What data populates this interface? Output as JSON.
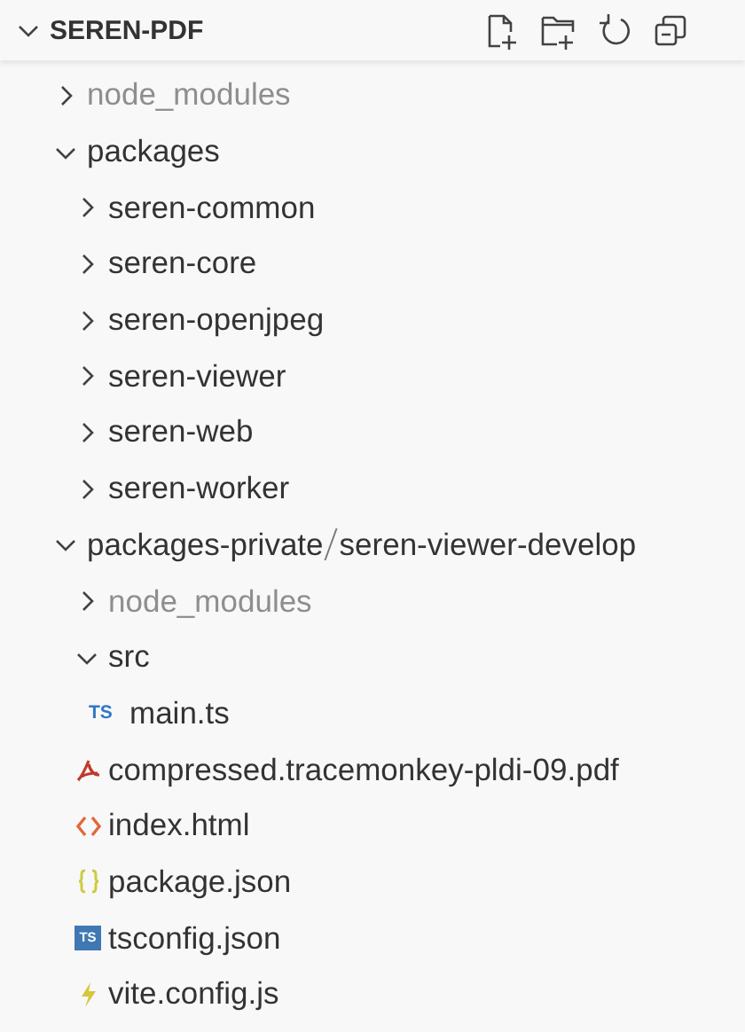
{
  "header": {
    "title": "SEREN-PDF",
    "expanded": true,
    "actions": [
      {
        "kind": "new-file"
      },
      {
        "kind": "new-folder"
      },
      {
        "kind": "refresh"
      },
      {
        "kind": "collapse-all"
      }
    ]
  },
  "tree": [
    {
      "kind": "folder",
      "name": "node_modules",
      "expanded": false,
      "ignored": true
    },
    {
      "kind": "folder",
      "name": "packages",
      "expanded": true,
      "ignored": false,
      "children": [
        {
          "kind": "folder",
          "name": "seren-common",
          "expanded": false,
          "ignored": false
        },
        {
          "kind": "folder",
          "name": "seren-core",
          "expanded": false,
          "ignored": false
        },
        {
          "kind": "folder",
          "name": "seren-openjpeg",
          "expanded": false,
          "ignored": false
        },
        {
          "kind": "folder",
          "name": "seren-viewer",
          "expanded": false,
          "ignored": false
        },
        {
          "kind": "folder",
          "name": "seren-web",
          "expanded": false,
          "ignored": false
        },
        {
          "kind": "folder",
          "name": "seren-worker",
          "expanded": false,
          "ignored": false
        }
      ]
    },
    {
      "kind": "compact-folder",
      "segments": [
        "packages-private",
        "seren-viewer-develop"
      ],
      "expanded": true,
      "ignored": false,
      "children": [
        {
          "kind": "folder",
          "name": "node_modules",
          "expanded": false,
          "ignored": true
        },
        {
          "kind": "folder",
          "name": "src",
          "expanded": true,
          "ignored": false,
          "children": [
            {
              "kind": "ts-file",
              "icon_text": "TS",
              "name": "main.ts"
            }
          ]
        },
        {
          "kind": "pdf-file",
          "name": "compressed.tracemonkey-pldi-09.pdf"
        },
        {
          "kind": "html-file",
          "name": "index.html"
        },
        {
          "kind": "json-file",
          "name": "package.json"
        },
        {
          "kind": "tsconfig-file",
          "icon_text": "TS",
          "name": "tsconfig.json"
        },
        {
          "kind": "js-file",
          "name": "vite.config.js"
        }
      ]
    }
  ]
}
